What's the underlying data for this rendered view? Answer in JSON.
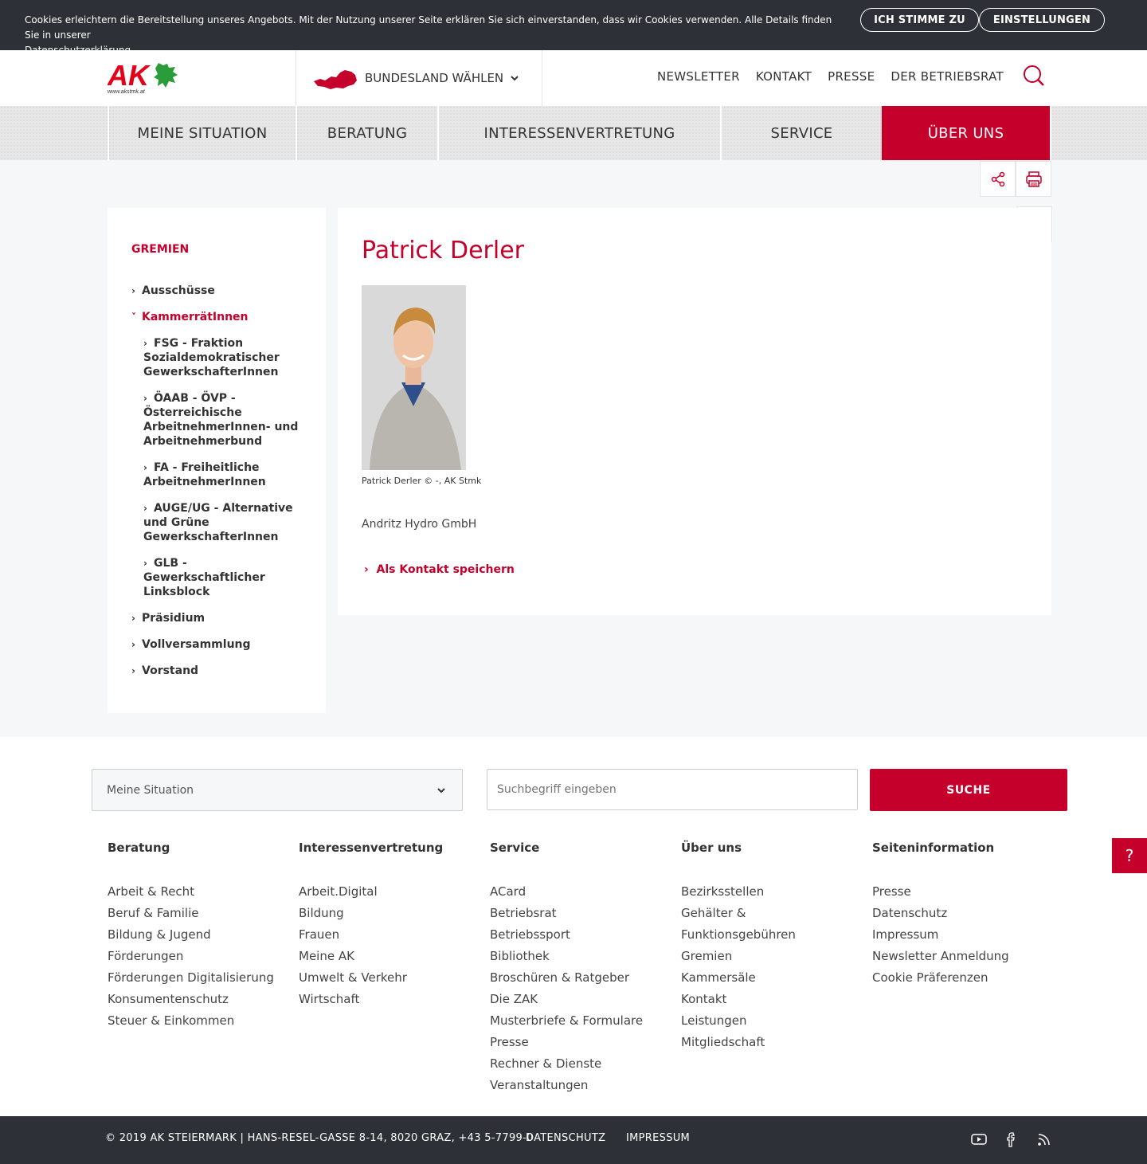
{
  "cookie": {
    "text": "Cookies erleichtern die Bereitstellung unseres Angebots. Mit der Nutzung unserer Seite erklären Sie sich einverstanden, dass wir Cookies verwenden. Alle Details finden Sie in unserer",
    "link": "Datenschutzerklärung",
    "agree": "ICH STIMME ZU",
    "settings": "EINSTELLUNGEN"
  },
  "header": {
    "logo_text": "AK",
    "logo_url": "www.akstmk.at",
    "bundesland": "BUNDESLAND WÄHLEN",
    "links": [
      "NEWSLETTER",
      "KONTAKT",
      "PRESSE",
      "DER BETRIEBSRAT"
    ]
  },
  "mainnav": [
    "MEINE SITUATION",
    "BERATUNG",
    "INTERESSENVERTRETUNG",
    "SERVICE",
    "ÜBER UNS"
  ],
  "sidebar": {
    "title": "GREMIEN",
    "items": [
      "Ausschüsse",
      "KammerrätInnen",
      "FSG - Fraktion Sozialdemokratischer GewerkschafterInnen",
      "ÖAAB - ÖVP - Österreichische ArbeitnehmerInnen- und Arbeitnehmerbund",
      "FA - Freiheitliche ArbeitnehmerInnen",
      "AUGE/UG - Alternative und Grüne GewerkschafterInnen",
      "GLB - Gewerkschaftlicher Linksblock",
      "Präsidium",
      "Vollversammlung",
      "Vorstand"
    ]
  },
  "content": {
    "name": "Patrick Derler",
    "caption": "Patrick Derler © -, AK Stmk",
    "company": "Andritz Hydro GmbH",
    "contact": "Als Kontakt speichern"
  },
  "footer": {
    "select": "Meine Situation",
    "search_placeholder": "Suchbegriff eingeben",
    "search_button": "SUCHE",
    "columns": [
      {
        "title": "Beratung",
        "items": [
          "Arbeit & Recht",
          "Beruf & Familie",
          "Bildung & Jugend",
          "Förderungen",
          "Förderungen Digitalisierung",
          "Konsumentenschutz",
          "Steuer & Einkommen"
        ]
      },
      {
        "title": "Interessenvertretung",
        "items": [
          "Arbeit.Digital",
          "Bildung",
          "Frauen",
          "Meine AK",
          "Umwelt & Verkehr",
          "Wirtschaft"
        ]
      },
      {
        "title": "Service",
        "items": [
          "ACard",
          "Betriebsrat",
          "Betriebssport",
          "Bibliothek",
          "Broschüren & Ratgeber",
          "Die ZAK",
          "Musterbriefe & Formulare",
          "Presse",
          "Rechner & Dienste",
          "Veranstaltungen"
        ]
      },
      {
        "title": "Über uns",
        "items": [
          "Bezirksstellen",
          "Gehälter &",
          "Funktionsgebühren",
          "Gremien",
          "Kammersäle",
          "Kontakt",
          "Leistungen",
          "Mitgliedschaft"
        ]
      },
      {
        "title": "Seiteninformation",
        "items": [
          "Presse",
          "Datenschutz",
          "Impressum",
          "Newsletter Anmeldung",
          "Cookie Präferenzen"
        ]
      }
    ],
    "help": "?"
  },
  "bottom": {
    "copyright": "© 2019 AK STEIERMARK | HANS-RESEL-GASSE 8-14, 8020 GRAZ, +43 5-7799-0",
    "links": [
      "DATENSCHUTZ",
      "IMPRESSUM"
    ]
  },
  "colors": {
    "brand_red": "#c4002b",
    "dark": "#2d3036",
    "logo_green": "#2a9d3a"
  }
}
